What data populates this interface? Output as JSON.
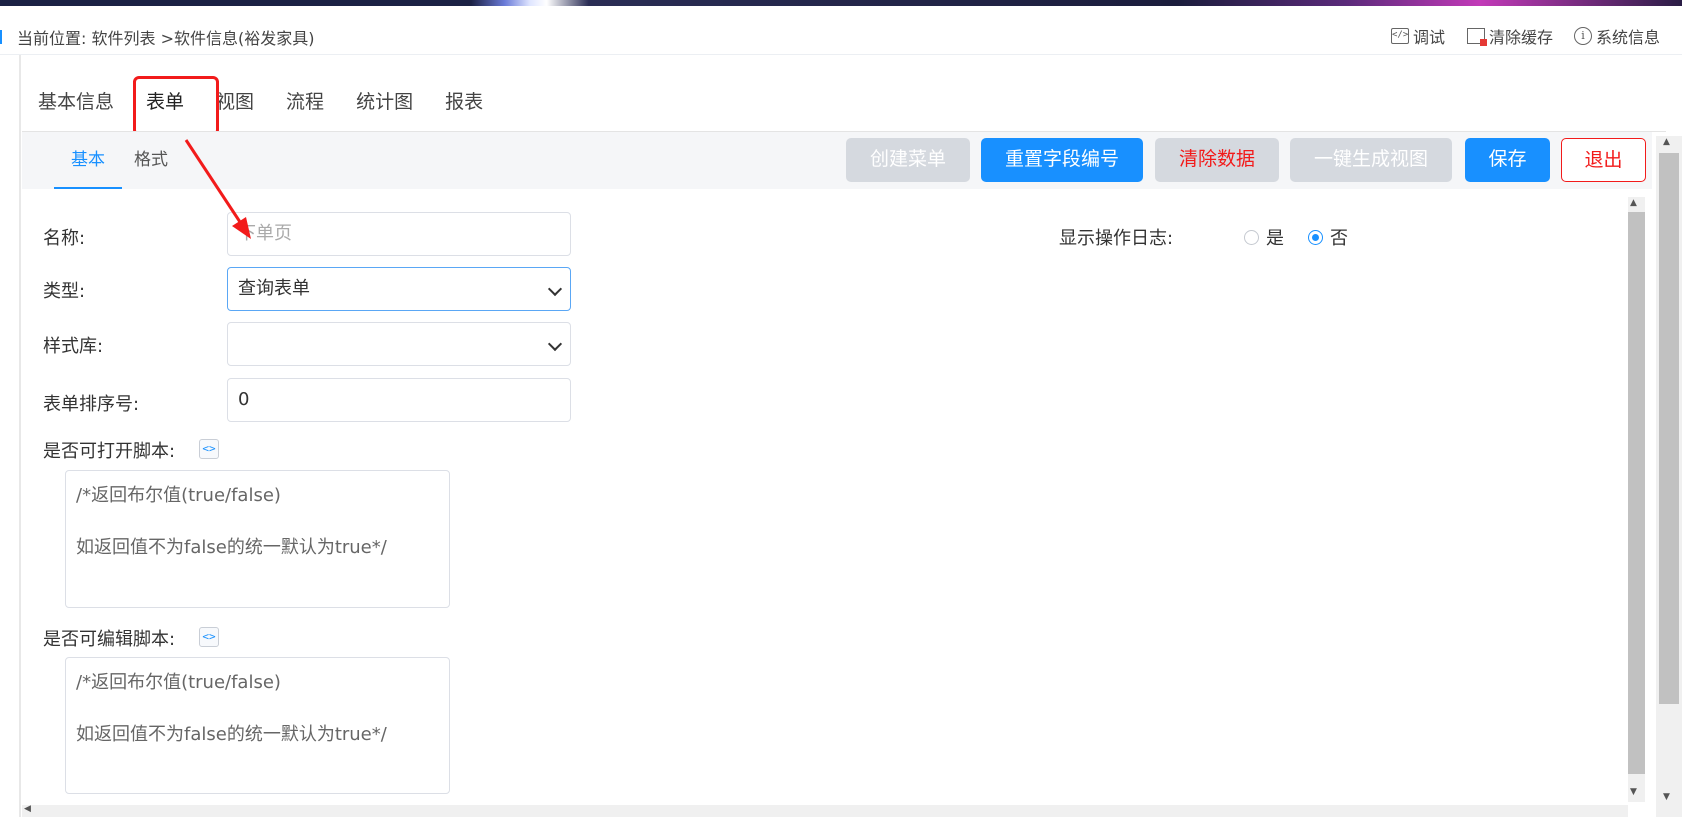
{
  "breadcrumb": "当前位置: 软件列表 >软件信息(裕发家具)",
  "tools": {
    "debug": "调试",
    "clear_cache": "清除缓存",
    "system_info": "系统信息"
  },
  "main_tabs": [
    {
      "label": "基本信息"
    },
    {
      "label": "表单",
      "active": true
    },
    {
      "label": "视图"
    },
    {
      "label": "流程"
    },
    {
      "label": "统计图"
    },
    {
      "label": "报表"
    }
  ],
  "sub_tabs": {
    "basic": "基本",
    "format": "格式"
  },
  "buttons": {
    "create_menu": "创建菜单",
    "reset_field_no": "重置字段编号",
    "clear_data": "清除数据",
    "gen_view": "一键生成视图",
    "save": "保存",
    "exit": "退出"
  },
  "form": {
    "name_label": "名称:",
    "name_placeholder": "下单页",
    "type_label": "类型:",
    "type_value": "查询表单",
    "style_label": "样式库:",
    "style_value": "",
    "order_label": "表单排序号:",
    "order_value": "0",
    "open_script_label": "是否可打开脚本:",
    "open_script_line1": "/*返回布尔值(true/false)",
    "open_script_line2": "如返回值不为false的统一默认为true*/",
    "edit_script_label": "是否可编辑脚本:",
    "edit_script_line1": "/*返回布尔值(true/false)",
    "edit_script_line2": "如返回值不为false的统一默认为true*/",
    "log_label": "显示操作日志:",
    "log_yes": "是",
    "log_no": "否",
    "log_selected": "否"
  },
  "colors": {
    "primary": "#1890ff",
    "danger": "#f21b1b",
    "disabled": "#d5d9df",
    "annotation": "#f21b1b"
  }
}
